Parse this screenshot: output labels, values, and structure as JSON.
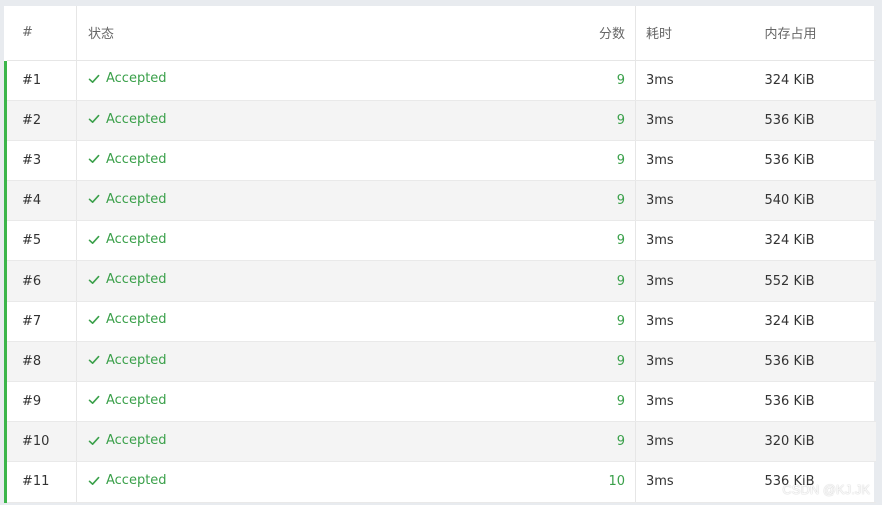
{
  "table": {
    "headers": {
      "id": "#",
      "status": "状态",
      "score": "分数",
      "time": "耗时",
      "memory": "内存占用"
    },
    "rows": [
      {
        "id": "#1",
        "status": "Accepted",
        "score": "9",
        "time": "3ms",
        "memory": "324 KiB"
      },
      {
        "id": "#2",
        "status": "Accepted",
        "score": "9",
        "time": "3ms",
        "memory": "536 KiB"
      },
      {
        "id": "#3",
        "status": "Accepted",
        "score": "9",
        "time": "3ms",
        "memory": "536 KiB"
      },
      {
        "id": "#4",
        "status": "Accepted",
        "score": "9",
        "time": "3ms",
        "memory": "540 KiB"
      },
      {
        "id": "#5",
        "status": "Accepted",
        "score": "9",
        "time": "3ms",
        "memory": "324 KiB"
      },
      {
        "id": "#6",
        "status": "Accepted",
        "score": "9",
        "time": "3ms",
        "memory": "552 KiB"
      },
      {
        "id": "#7",
        "status": "Accepted",
        "score": "9",
        "time": "3ms",
        "memory": "324 KiB"
      },
      {
        "id": "#8",
        "status": "Accepted",
        "score": "9",
        "time": "3ms",
        "memory": "536 KiB"
      },
      {
        "id": "#9",
        "status": "Accepted",
        "score": "9",
        "time": "3ms",
        "memory": "536 KiB"
      },
      {
        "id": "#10",
        "status": "Accepted",
        "score": "9",
        "time": "3ms",
        "memory": "320 KiB"
      },
      {
        "id": "#11",
        "status": "Accepted",
        "score": "10",
        "time": "3ms",
        "memory": "536 KiB"
      }
    ]
  },
  "watermark": "CSDN @KJ.JK",
  "colors": {
    "accepted": "#3aa04a",
    "accent_bar": "#3bb54a",
    "row_alt": "#f4f4f4"
  },
  "icons": {
    "status_icon": "check-icon"
  }
}
